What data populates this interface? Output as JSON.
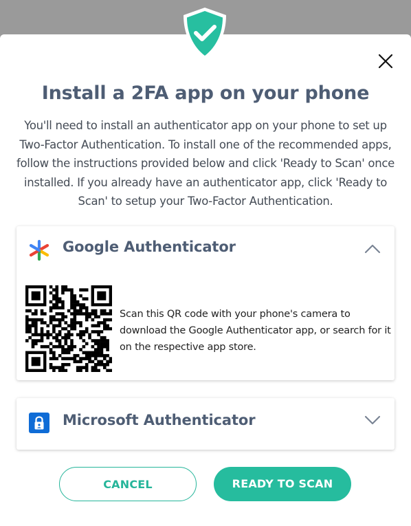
{
  "dialog": {
    "title": "Install a 2FA app on your phone",
    "description": "You'll need to install an authenticator app on your phone to set up Two-Factor Authentication. To install one of the recommended apps, follow the instructions provided below and click 'Ready to Scan' once installed. If you already have an authenticator app, click 'Ready to Scan' to setup your Two-Factor Authentication.",
    "header_icon": "shield-check-icon",
    "close_icon": "close-icon"
  },
  "apps": [
    {
      "name": "Google Authenticator",
      "icon": "google-authenticator-icon",
      "expanded": true,
      "chevron": "chevron-up-icon",
      "qr_instructions": "Scan this QR code with your phone's camera to download the Google Authenticator app, or search for it on the respective app store."
    },
    {
      "name": "Microsoft Authenticator",
      "icon": "microsoft-authenticator-icon",
      "expanded": false,
      "chevron": "chevron-down-icon"
    }
  ],
  "buttons": {
    "cancel": "CANCEL",
    "ready": "READY TO SCAN"
  },
  "colors": {
    "accent": "#26bc9e",
    "title": "#4e5d74",
    "overlay": "#9a9a9a"
  }
}
